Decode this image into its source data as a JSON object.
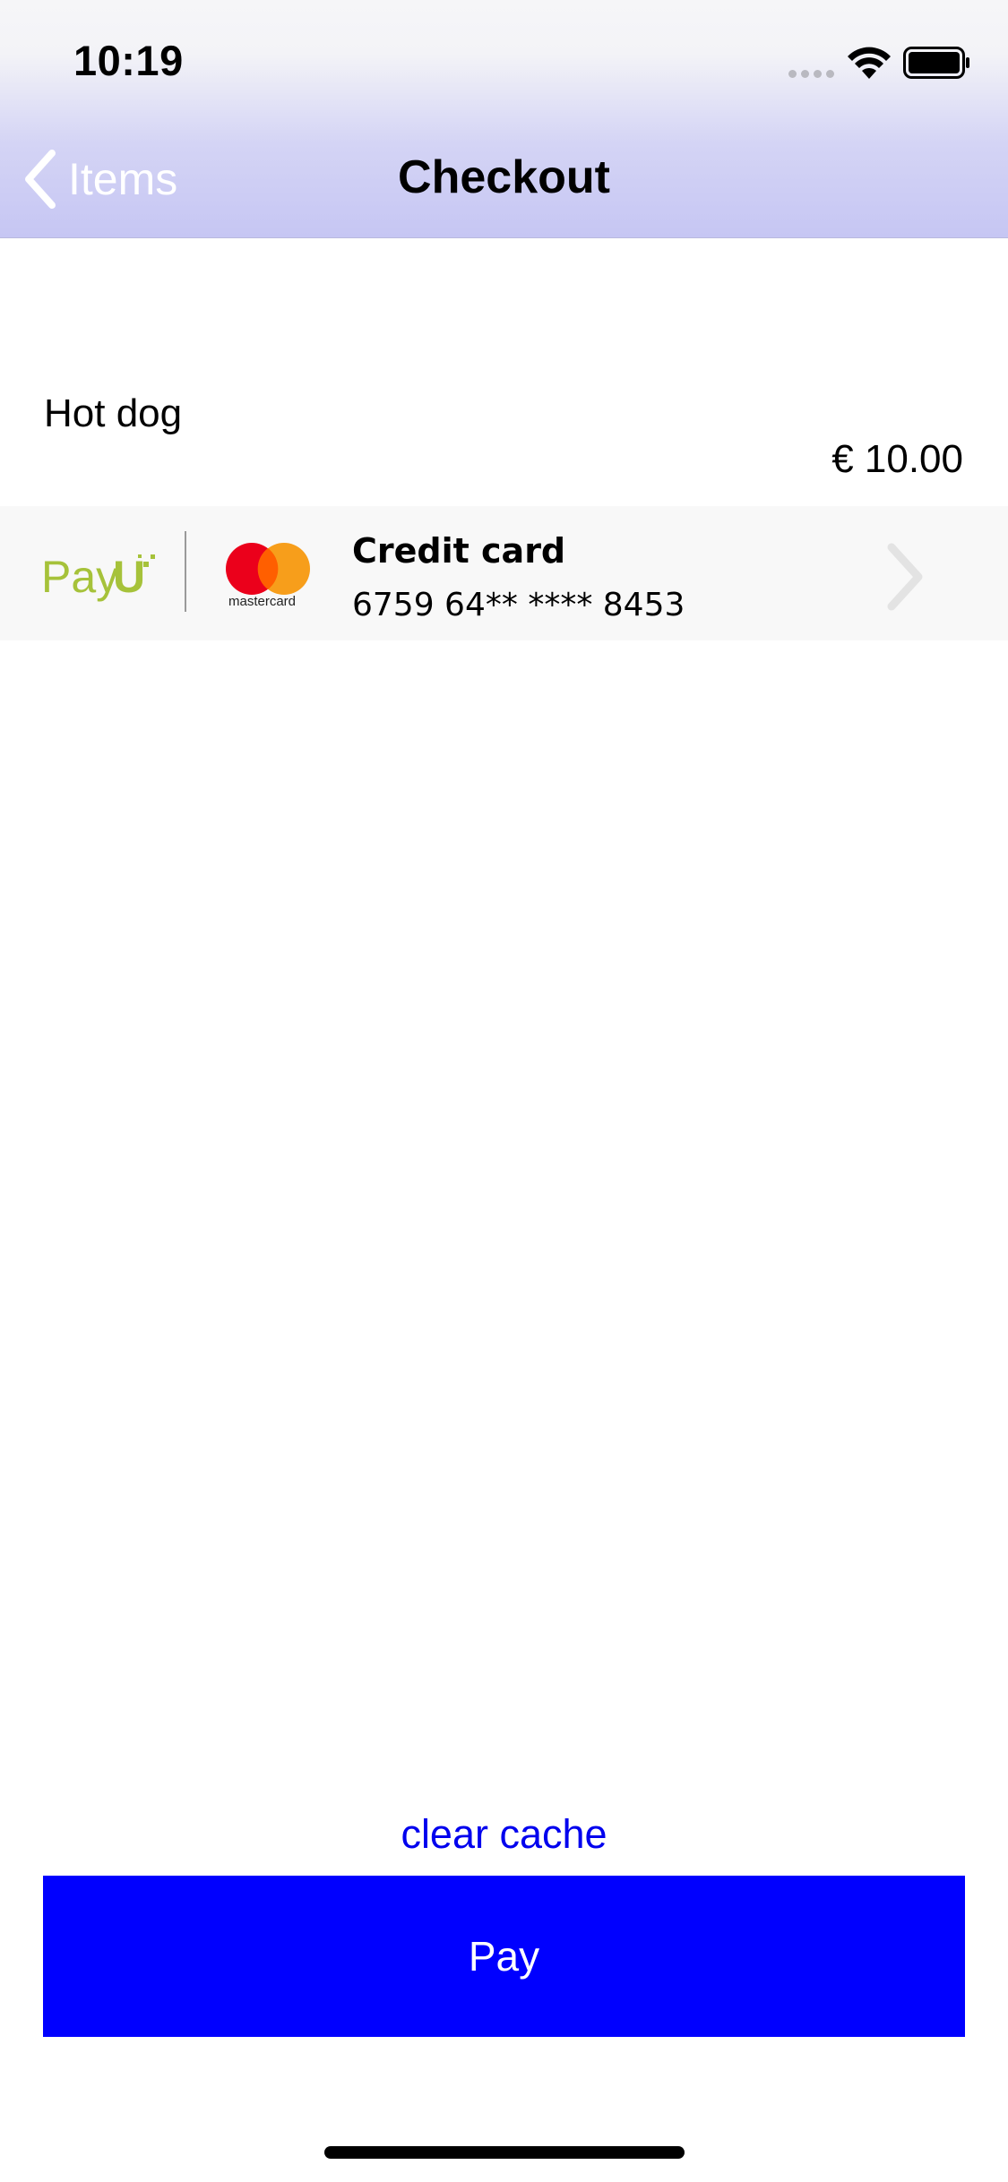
{
  "status_bar": {
    "time": "10:19",
    "icons": [
      "signal-icon",
      "wifi-icon",
      "battery-icon"
    ]
  },
  "nav": {
    "back_label": "Items",
    "title": "Checkout",
    "back_icon": "chevron-left-icon"
  },
  "item": {
    "name": "Hot dog",
    "price": "€ 10.00"
  },
  "payment_method": {
    "provider_logo": "PayU",
    "card_brand": "mastercard",
    "title": "Credit card",
    "masked_number": "6759 64** **** 8453",
    "chevron_icon": "chevron-right-icon"
  },
  "actions": {
    "clear_cache_label": "clear cache",
    "pay_label": "Pay"
  },
  "colors": {
    "accent_blue": "#0000ff",
    "link_blue": "#0000ee",
    "nav_gradient_bottom": "#c6c6f3",
    "payu_green": "#a6c23a",
    "mc_red": "#eb001b",
    "mc_orange": "#f79e1b"
  }
}
